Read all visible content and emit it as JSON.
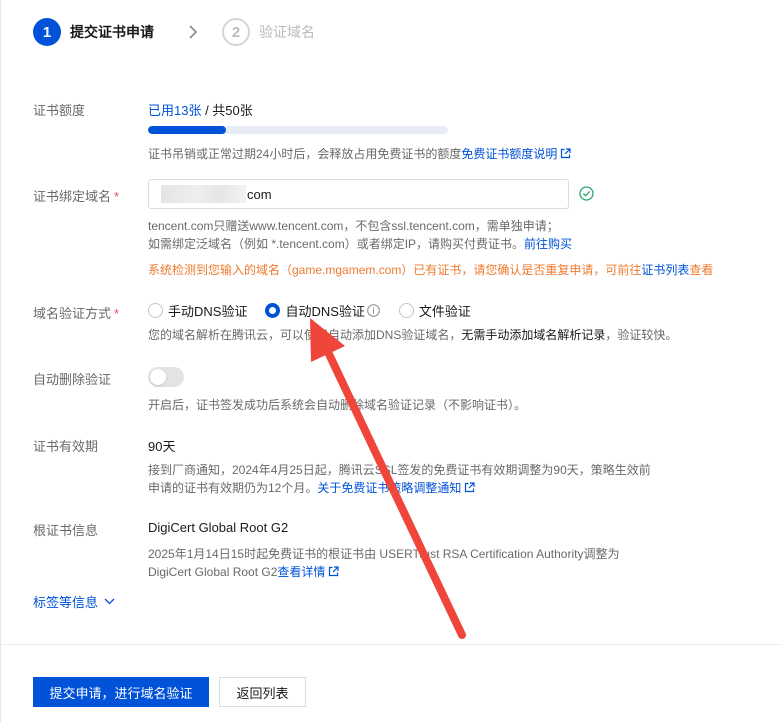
{
  "steps": [
    {
      "number": "1",
      "label": "提交证书申请"
    },
    {
      "number": "2",
      "label": "验证域名"
    }
  ],
  "quota": {
    "label": "证书额度",
    "used": "已用13张",
    "total": " / 共50张",
    "progress_fraction": 0.26,
    "help_text": "证书吊销或正常过期24小时后，会释放占用免费证书的额度",
    "help_link": "免费证书额度说明"
  },
  "domain": {
    "label": "证书绑定域名",
    "required_mark": "*",
    "value_suffix": "com",
    "help_line1": "tencent.com只赠送www.tencent.com，不包含ssl.tencent.com，需单独申请；",
    "help_line2_prefix": "如需绑定泛域名（例如 *.tencent.com）或者绑定IP，请购买付费证书。",
    "help_line2_link": "前往购买",
    "warning_prefix": "系统检测到您输入的域名（game.mgamem.com）已有证书，请您确认是否重复申请，可前往",
    "warning_link": "证书列表",
    "warning_suffix": "查看"
  },
  "verify": {
    "label": "域名验证方式",
    "required_mark": "*",
    "options": [
      "手动DNS验证",
      "自动DNS验证",
      "文件验证"
    ],
    "selected": "自动DNS验证",
    "help_prefix": "您的域名解析在腾讯云，可以使用自动添加DNS验证域名，",
    "help_strong": "无需手动添加域名解析记录",
    "help_suffix": "，验证较快。"
  },
  "auto_delete": {
    "label": "自动删除验证",
    "enabled": false,
    "help": "开启后，证书签发成功后系统会自动删除域名验证记录（不影响证书）。"
  },
  "validity": {
    "label": "证书有效期",
    "value": "90天",
    "help_line1": "接到厂商通知，2024年4月25日起，腾讯云SSL签发的免费证书有效期调整为90天，策略生效前",
    "help_line2": "申请的证书有效期仍为12个月。",
    "help_link": "关于免费证书策略调整通知"
  },
  "root_cert": {
    "label": "根证书信息",
    "value": "DigiCert Global Root G2",
    "help_line1": "2025年1月14日15时起免费证书的根证书由 USERTrust RSA Certification Authority调整为",
    "help_line2": "DigiCert Global Root G2",
    "help_link": "查看详情"
  },
  "more": {
    "label": "标签等信息"
  },
  "buttons": {
    "submit": "提交申请，进行域名验证",
    "back": "返回列表"
  },
  "colors": {
    "brand": "#0052d9",
    "warning": "#ed7b2f",
    "success": "#2ba471",
    "annotation_arrow": "#f0453a"
  }
}
